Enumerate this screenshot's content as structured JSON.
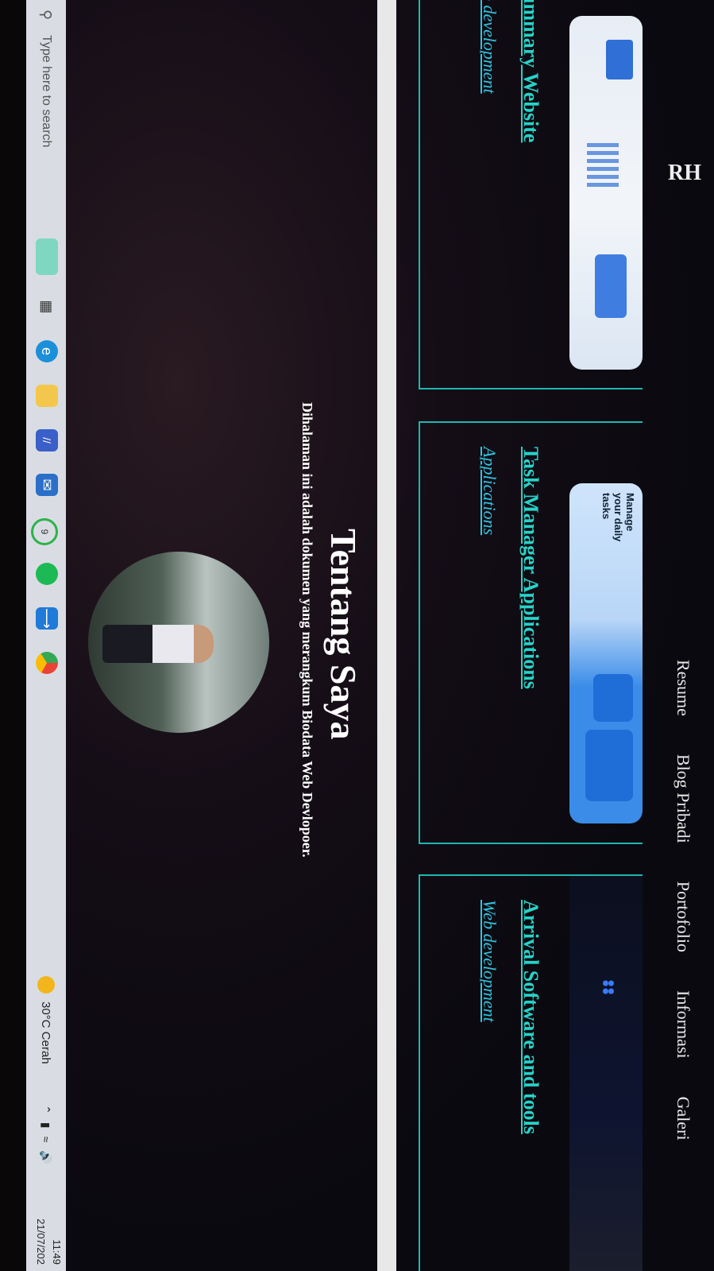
{
  "nav": {
    "logo": "RH",
    "items": [
      "Resume",
      "Blog Pribadi",
      "Portofolio",
      "Informasi",
      "Galeri"
    ]
  },
  "cards": [
    {
      "title": "ummary Website",
      "subtitle": "b development"
    },
    {
      "title": "Task Manager Applications",
      "subtitle": "Applications",
      "thumb_text": "Manage your daily tasks"
    },
    {
      "title": "Arrival Software and tools",
      "subtitle": "Web development"
    }
  ],
  "about": {
    "title": "Tentang Saya",
    "description": "Dihalaman ini adalah dokumen yang merangkum Biodata Web Devlopoer."
  },
  "taskbar": {
    "search_placeholder": "Type here to search",
    "weather": "30°C  Cerah",
    "time": "11:49",
    "date": "21/07/202"
  },
  "colors": {
    "accent": "#1fb7b1",
    "title": "#27d3c8",
    "subtitle": "#2fc4e0",
    "background": "#0c0a0e"
  },
  "icons": [
    "search-icon",
    "task-view-icon",
    "edge-icon",
    "file-explorer-icon",
    "visual-studio-icon",
    "mail-icon",
    "whatsapp-icon",
    "spotify-icon",
    "vscode-icon",
    "chrome-icon",
    "weather-icon",
    "tray-chevron-icon",
    "battery-icon",
    "wifi-icon",
    "volume-icon"
  ]
}
